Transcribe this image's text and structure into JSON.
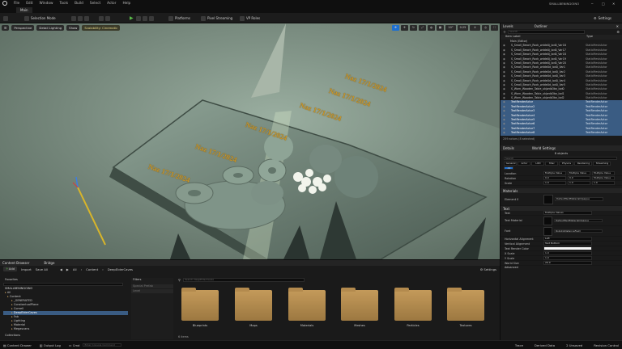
{
  "menubar": {
    "items": [
      "File",
      "Edit",
      "Window",
      "Tools",
      "Build",
      "Select",
      "Actor",
      "Help"
    ],
    "project_name": "SMALLBENINGOINO"
  },
  "tab": {
    "label": "Main"
  },
  "toolbar": {
    "selection_mode": "Selection Mode",
    "platforms": "Platforms",
    "pixel_streaming": "Pixel Streaming",
    "vp_roles": "VP Roles",
    "settings": "Settings"
  },
  "viewport": {
    "perspective": "Perspective",
    "lighting": "Detail Lighting",
    "show": "Show",
    "scalability": "Scalability: Cinematic",
    "snap_values": [
      "10°",
      "0.25",
      "4"
    ],
    "texts": [
      "Naz 17/1/2024",
      "Naz 17/1/2024",
      "Naz 17/1/2024",
      "Naz 17/1/2024",
      "Naz 17/1/2024",
      "Naz 17/1/2024"
    ]
  },
  "outliner": {
    "tabs": [
      "Levels",
      "Outliner"
    ],
    "search_placeholder": "Search...",
    "col_item": "Item Label",
    "col_type": "Type",
    "root": "Main (Editor)",
    "rows": [
      {
        "name": "S_Small_Beach_Rock_wdde0j_lod0_Var16",
        "type": "StaticMeshActor",
        "sel": false
      },
      {
        "name": "S_Small_Beach_Rock_wdde0j_lod0_Var17",
        "type": "StaticMeshActor",
        "sel": false
      },
      {
        "name": "S_Small_Beach_Rock_wdde0j_lod0_Var18",
        "type": "StaticMeshActor",
        "sel": false
      },
      {
        "name": "S_Small_Beach_Rock_wdde0j_lod0_Var19",
        "type": "StaticMeshActor",
        "sel": false
      },
      {
        "name": "S_Small_Beach_Rock_wdde0j_lod0_Var20",
        "type": "StaticMeshActor",
        "sel": false
      },
      {
        "name": "S_Small_Beach_Rock_wdde0d_lod0_Var1",
        "type": "StaticMeshActor",
        "sel": false
      },
      {
        "name": "S_Small_Beach_Rock_wdde0d_lod0_Var2",
        "type": "StaticMeshActor",
        "sel": false
      },
      {
        "name": "S_Small_Beach_Rock_wdde0d_lod0_Var3",
        "type": "StaticMeshActor",
        "sel": false
      },
      {
        "name": "S_Small_Beach_Rock_wdde0d_lod0_Var4",
        "type": "StaticMeshActor",
        "sel": false
      },
      {
        "name": "S_Small_Beach_Rock_wdde0d_lod0_Var5",
        "type": "StaticMeshActor",
        "sel": false
      },
      {
        "name": "S_Worn_Wooden_Table_ukjwdb3tw_lod0",
        "type": "StaticMeshActor",
        "sel": false
      },
      {
        "name": "S_Worn_Wooden_Table_ukjwdb3tw_lod1",
        "type": "StaticMeshActor",
        "sel": false
      },
      {
        "name": "S_Worn_Wooden_Table_ukjwdb3tw_lod2",
        "type": "StaticMeshActor",
        "sel": false
      },
      {
        "name": "TextRenderActor",
        "type": "TextRenderActor",
        "sel": true
      },
      {
        "name": "TextRenderActor2",
        "type": "TextRenderActor",
        "sel": true
      },
      {
        "name": "TextRenderActor3",
        "type": "TextRenderActor",
        "sel": true
      },
      {
        "name": "TextRenderActor4",
        "type": "TextRenderActor",
        "sel": true
      },
      {
        "name": "TextRenderActor5",
        "type": "TextRenderActor",
        "sel": true
      },
      {
        "name": "TextRenderActor6",
        "type": "TextRenderActor",
        "sel": true
      },
      {
        "name": "TextRenderActor7",
        "type": "TextRenderActor",
        "sel": true
      },
      {
        "name": "TextRenderActor8",
        "type": "TextRenderActor",
        "sel": true
      }
    ],
    "count": "259 actors (8 selected)"
  },
  "details": {
    "tabs": [
      "Details",
      "World Settings"
    ],
    "objects": "8 objects",
    "search_placeholder": "Search",
    "filter_tabs": [
      "General",
      "Actor",
      "LOD",
      "Misc",
      "Physics",
      "Rendering",
      "Streaming",
      "All"
    ],
    "transform": [
      {
        "label": "Location",
        "v": [
          "Multiple Value",
          "Multiple Value",
          "Multiple Value"
        ]
      },
      {
        "label": "Rotation",
        "v": [
          "0.0",
          "0.0",
          "Multiple Value"
        ]
      },
      {
        "label": "Scale",
        "v": [
          "1.0",
          "1.0",
          "1.0"
        ]
      }
    ],
    "materials_header": "Materials",
    "element": "Element 0",
    "material_name": "DefaultTextMaterialOpaque",
    "text_header": "Text",
    "text_props": [
      {
        "label": "Text",
        "v": "Multiple Values"
      },
      {
        "label": "Text Material",
        "v": "DefaultTextMaterialOpaque"
      },
      {
        "label": "Font",
        "v": "RobotoDistanceField"
      },
      {
        "label": "Horizontal Alignment",
        "v": "Left"
      },
      {
        "label": "Vertical Alignment",
        "v": "Text Bottom"
      },
      {
        "label": "Text Render Color",
        "v": ""
      },
      {
        "label": "X Scale",
        "v": "1.0"
      },
      {
        "label": "Y Scale",
        "v": "1.0"
      },
      {
        "label": "World Size",
        "v": "26.0"
      }
    ],
    "advanced": "Advanced"
  },
  "content_browser": {
    "tabs": [
      "Content Browser",
      "Bridge"
    ],
    "add": "Add",
    "import": "Import",
    "save_all": "Save All",
    "path": [
      "All",
      "Content",
      "DeepElderCaves"
    ],
    "settings": "Settings",
    "favorites": "Favorites",
    "project": "SMALLBENINGOINO",
    "tree": [
      {
        "label": "All",
        "sel": false
      },
      {
        "label": "Content",
        "sel": false
      },
      {
        "label": "_GENERATED",
        "sel": false
      },
      {
        "label": "ConstantualPlane",
        "sel": false
      },
      {
        "label": "Cornell",
        "sel": false
      },
      {
        "label": "DeepElderCaves",
        "sel": true
      },
      {
        "label": "Fab",
        "sel": false
      },
      {
        "label": "Lighting",
        "sel": false
      },
      {
        "label": "Material",
        "sel": false
      },
      {
        "label": "Megascans",
        "sel": false
      }
    ],
    "collections": "Collections",
    "filters": "Filters",
    "filter_items": [
      "Special Prefab",
      "Level"
    ],
    "search_placeholder": "Search DeepElderCaves",
    "folders": [
      "Blueprints",
      "Maps",
      "Materials",
      "Meshes",
      "Particles",
      "Textures"
    ],
    "item_count": "6 items"
  },
  "status": {
    "content_drawer": "Content Drawer",
    "output_log": "Output Log",
    "cmd": "Cmd",
    "console_placeholder": "Enter Console Command",
    "trace": "Trace",
    "derived_data": "Derived Data",
    "unsaved": "2 Unsaved",
    "revision": "Revision Control"
  }
}
